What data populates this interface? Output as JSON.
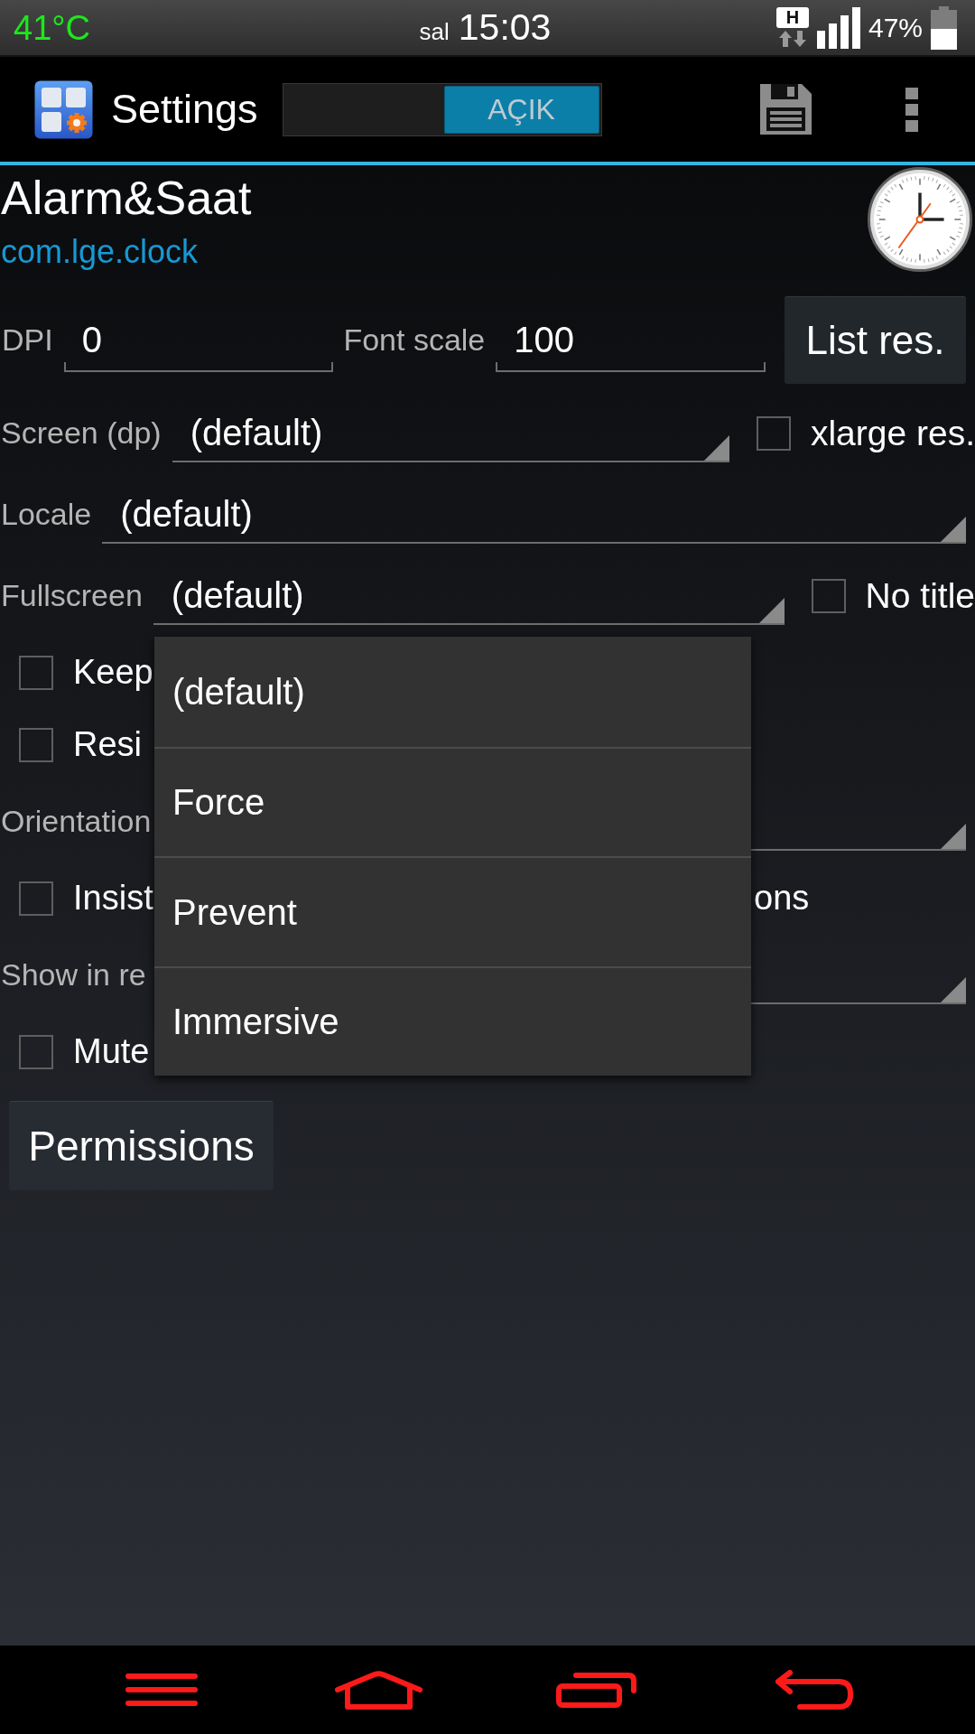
{
  "status_bar": {
    "temperature": "41°C",
    "day": "sal",
    "time": "15:03",
    "network": "H",
    "battery": "47%"
  },
  "action_bar": {
    "title": "Settings",
    "toggle": {
      "label": "AÇIK",
      "on": true
    }
  },
  "app": {
    "name": "Alarm&Saat",
    "package": "com.lge.clock"
  },
  "fields": [
    {
      "label": "DPI",
      "value": "0"
    },
    {
      "label": "Font scale",
      "value": "100"
    }
  ],
  "list_button": "List res.",
  "settings": [
    {
      "kind": "spinner",
      "label": "Screen (dp)",
      "value": "(default)",
      "checkbox": {
        "label": "xlarge res.",
        "checked": false
      }
    },
    {
      "kind": "spinner",
      "label": "Locale",
      "value": "(default)"
    },
    {
      "kind": "spinner",
      "label": "Fullscreen",
      "value": "(default)",
      "checkbox": {
        "label": "No title",
        "checked": false
      },
      "options": [
        "(default)",
        "Force",
        "Prevent",
        "Immersive"
      ]
    },
    {
      "kind": "checkbox",
      "label": "Keep",
      "checked": false
    },
    {
      "kind": "checkbox",
      "label": "Resi",
      "checked": false
    },
    {
      "kind": "spinner",
      "label": "Orientation"
    },
    {
      "kind": "checkbox",
      "label": "Insist",
      "label_end": "ons",
      "checked": false
    },
    {
      "kind": "spinner",
      "label": "Show in re"
    },
    {
      "kind": "checkbox",
      "label": "Mute",
      "checked": false
    }
  ],
  "permissions_button": "Permissions"
}
